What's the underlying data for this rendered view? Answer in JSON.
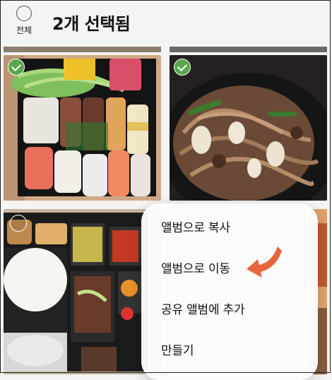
{
  "header": {
    "select_all_label": "전체",
    "title": "2개 선택됨"
  },
  "photos": [
    {
      "name": "sushi",
      "selected": true
    },
    {
      "name": "japchae",
      "selected": true
    },
    {
      "name": "bento",
      "selected": false
    }
  ],
  "menu": {
    "items": [
      {
        "label": "앨범으로 복사"
      },
      {
        "label": "앨범으로 이동"
      },
      {
        "label": "공유 앨범에 추가"
      },
      {
        "label": "만들기"
      }
    ]
  },
  "annotation": {
    "arrow_color": "#e8643a"
  },
  "colors": {
    "check_green": "#5aa64b"
  }
}
